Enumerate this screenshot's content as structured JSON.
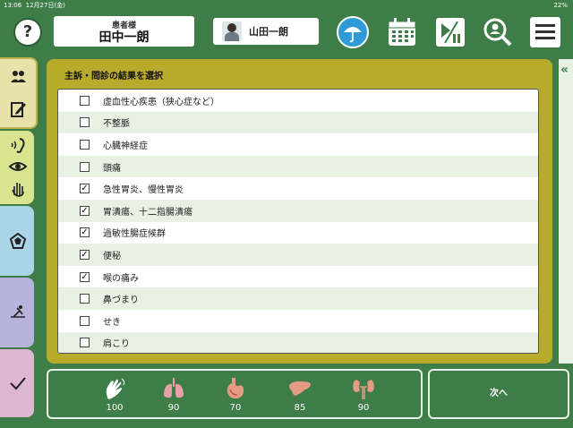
{
  "status": {
    "time": "13:06",
    "date": "12月27日(金)",
    "battery": "22%"
  },
  "header": {
    "help_label": "?",
    "patient_label": "患者様",
    "patient_name": "田中一朗",
    "doctor_name": "山田一朗"
  },
  "panel": {
    "title": "主訴・問診の結果を選択",
    "items": [
      {
        "label": "虚血性心疾患（狭心症など）",
        "checked": false
      },
      {
        "label": "不整脈",
        "checked": false
      },
      {
        "label": "心臓神経症",
        "checked": false
      },
      {
        "label": "頭痛",
        "checked": false
      },
      {
        "label": "急性胃炎、慢性胃炎",
        "checked": true
      },
      {
        "label": "胃潰瘍、十二指腸潰瘍",
        "checked": true
      },
      {
        "label": "過敏性腸症候群",
        "checked": true
      },
      {
        "label": "便秘",
        "checked": true
      },
      {
        "label": "喉の痛み",
        "checked": true
      },
      {
        "label": "鼻づまり",
        "checked": false
      },
      {
        "label": "せき",
        "checked": false
      },
      {
        "label": "肩こり",
        "checked": false
      }
    ]
  },
  "collapse_label": "«",
  "organs": [
    {
      "icon": "hand-icon",
      "value": "100"
    },
    {
      "icon": "lungs-icon",
      "value": "90"
    },
    {
      "icon": "stomach-icon",
      "value": "70"
    },
    {
      "icon": "liver-icon",
      "value": "85"
    },
    {
      "icon": "kidney-icon",
      "value": "90"
    }
  ],
  "next_label": "次へ",
  "colors": {
    "green": "#3f7d48",
    "olive": "#b8aa2b",
    "row_alt": "#e8f2e4"
  }
}
